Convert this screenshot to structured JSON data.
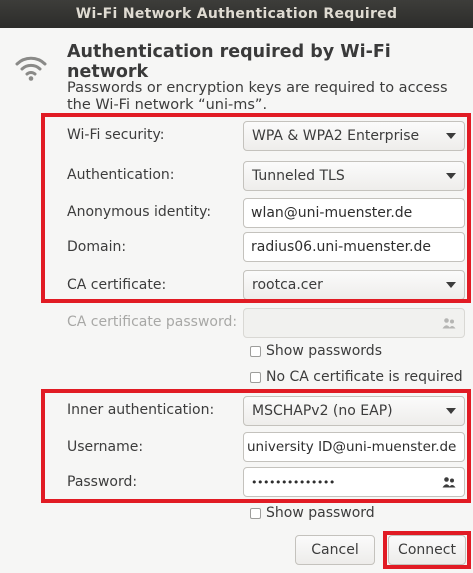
{
  "window": {
    "title": "Wi-Fi Network Authentication Required"
  },
  "icons": {
    "wifi": "wifi-icon",
    "password_storage": "people-icon",
    "dropdown": "chevron-down-icon"
  },
  "dialog": {
    "heading": "Authentication required by Wi-Fi network",
    "description": "Passwords or encryption keys are required to access the Wi-Fi network “uni-ms”."
  },
  "form": {
    "wifi_security": {
      "label": "Wi-Fi security:",
      "value": "WPA & WPA2 Enterprise"
    },
    "authentication": {
      "label": "Authentication:",
      "value": "Tunneled TLS"
    },
    "anonymous_identity": {
      "label": "Anonymous identity:",
      "value": "wlan@uni-muenster.de"
    },
    "domain": {
      "label": "Domain:",
      "value": "radius06.uni-muenster.de"
    },
    "ca_certificate": {
      "label": "CA certificate:",
      "value": "rootca.cer"
    },
    "ca_certificate_password": {
      "label": "CA certificate password:",
      "value": ""
    },
    "show_passwords": {
      "label": "Show passwords",
      "checked": false
    },
    "no_ca_required": {
      "label": "No CA certificate is required",
      "checked": false
    },
    "inner_authentication": {
      "label": "Inner authentication:",
      "value": "MSCHAPv2 (no EAP)"
    },
    "username": {
      "label": "Username:",
      "value": "university ID@uni-muenster.de"
    },
    "password": {
      "label": "Password:",
      "value": "••••••••••••••"
    },
    "show_password": {
      "label": "Show password",
      "checked": false
    }
  },
  "buttons": {
    "cancel": "Cancel",
    "connect": "Connect"
  },
  "colors": {
    "highlight": "#e11b24",
    "titlebar": "#2f2f2d",
    "background": "#f6f6f5"
  }
}
